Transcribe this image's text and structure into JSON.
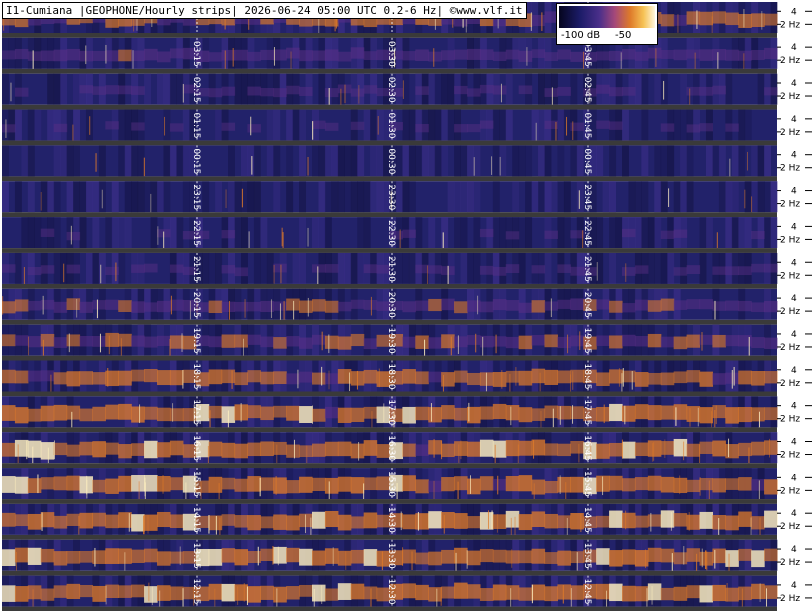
{
  "title": "I1-Cumiana |GEOPHONE/Hourly strips| 2026-06-24 05:00 UTC 0.2-6 Hz| ©www.vlf.it",
  "colorbar": {
    "label_low": "-100 dB",
    "label_high": "-50",
    "range_db": [
      -100,
      -50
    ]
  },
  "colors": {
    "background": "#ffffff",
    "strip_base": "#22226a",
    "strip_gap": "#3a3a3a",
    "signal_low": "#5a2f86",
    "signal_mid": "#de7a2a",
    "signal_high": "#fff0c0",
    "marker_line": "#ffffff"
  },
  "chart_data": {
    "type": "heatmap",
    "description_units": "hourly spectrogram strips, most recent hour at top",
    "y_axis_ticks": [
      "4",
      "2 Hz"
    ],
    "strips": [
      {
        "hour": "04",
        "markers": [
          "04:",
          "04:",
          ""
        ],
        "activity": 0.55
      },
      {
        "hour": "03",
        "markers": [
          "03:15",
          "03:30",
          "03:45"
        ],
        "activity": 0.35
      },
      {
        "hour": "02",
        "markers": [
          "02:15",
          "02:30",
          "02:45"
        ],
        "activity": 0.2
      },
      {
        "hour": "01",
        "markers": [
          "01:15",
          "01:30",
          "01:45"
        ],
        "activity": 0.15
      },
      {
        "hour": "00",
        "markers": [
          "00:15",
          "00:30",
          "00:45"
        ],
        "activity": 0.1
      },
      {
        "hour": "23",
        "markers": [
          "23:15",
          "23:30",
          "23:45"
        ],
        "activity": 0.12
      },
      {
        "hour": "22",
        "markers": [
          "22:15",
          "22:30",
          "22:45"
        ],
        "activity": 0.15
      },
      {
        "hour": "21",
        "markers": [
          "21:15",
          "21:30",
          "21:45"
        ],
        "activity": 0.18
      },
      {
        "hour": "20",
        "markers": [
          "20:15",
          "20:30",
          "20:45"
        ],
        "activity": 0.4
      },
      {
        "hour": "19",
        "markers": [
          "19:15",
          "19:30",
          "19:45"
        ],
        "activity": 0.5
      },
      {
        "hour": "18",
        "markers": [
          "18:15",
          "18:30",
          "18:45"
        ],
        "activity": 0.6
      },
      {
        "hour": "17",
        "markers": [
          "17:15",
          "17:30",
          "17:45"
        ],
        "activity": 0.7
      },
      {
        "hour": "16",
        "markers": [
          "16:15",
          "16:30",
          "16:45"
        ],
        "activity": 0.72
      },
      {
        "hour": "15",
        "markers": [
          "15:15",
          "15:30",
          "15:45"
        ],
        "activity": 0.7
      },
      {
        "hour": "14",
        "markers": [
          "14:15",
          "14:30",
          "14:45"
        ],
        "activity": 0.72
      },
      {
        "hour": "13",
        "markers": [
          "13:15",
          "13:30",
          "13:45"
        ],
        "activity": 0.7
      },
      {
        "hour": "12",
        "markers": [
          "12:15",
          "12:30",
          "12:45"
        ],
        "activity": 0.72
      }
    ]
  }
}
